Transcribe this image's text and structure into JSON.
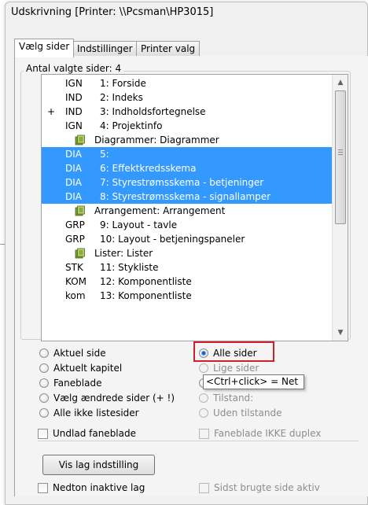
{
  "dialog": {
    "title": "Udskrivning [Printer: \\\\Pcsman\\HP3015]"
  },
  "tabs": [
    {
      "label": "Vælg sider",
      "active": true
    },
    {
      "label": "Indstillinger",
      "active": false
    },
    {
      "label": "Printer valg",
      "active": false
    }
  ],
  "group": {
    "label": "Antal valgte sider: 4"
  },
  "pages": [
    {
      "marker": "",
      "prefix": "IGN",
      "text": "1: Forside",
      "selected": false,
      "folder": false
    },
    {
      "marker": "",
      "prefix": "IND",
      "text": "2: Indeks",
      "selected": false,
      "folder": false
    },
    {
      "marker": "+",
      "prefix": "IND",
      "text": "3: Indholdsfortegnelse",
      "selected": false,
      "folder": false
    },
    {
      "marker": "",
      "prefix": "IGN",
      "text": "4: Projektinfo",
      "selected": false,
      "folder": false
    },
    {
      "marker": "",
      "prefix": "",
      "text": "Diagrammer: Diagrammer",
      "selected": false,
      "folder": true
    },
    {
      "marker": "",
      "prefix": "DIA",
      "text": "5:",
      "selected": true,
      "folder": false
    },
    {
      "marker": "",
      "prefix": "DIA",
      "text": "6: Effektkredsskema",
      "selected": true,
      "folder": false
    },
    {
      "marker": "",
      "prefix": "DIA",
      "text": "7: Styrestrømsskema - betjeninger",
      "selected": true,
      "folder": false
    },
    {
      "marker": "",
      "prefix": "DIA",
      "text": "8: Styrestrømsskema - signallamper",
      "selected": true,
      "folder": false
    },
    {
      "marker": "",
      "prefix": "",
      "text": "Arrangement: Arrangement",
      "selected": false,
      "folder": true
    },
    {
      "marker": "",
      "prefix": "GRP",
      "text": "9: Layout - tavle",
      "selected": false,
      "folder": false
    },
    {
      "marker": "",
      "prefix": "GRP",
      "text": "10: Layout - betjeningspaneler",
      "selected": false,
      "folder": false
    },
    {
      "marker": "",
      "prefix": "",
      "text": "Lister: Lister",
      "selected": false,
      "folder": true
    },
    {
      "marker": "",
      "prefix": "STK",
      "text": "11: Stykliste",
      "selected": false,
      "folder": false
    },
    {
      "marker": "",
      "prefix": "KOM",
      "text": "12: Komponentliste",
      "selected": false,
      "folder": false
    },
    {
      "marker": "",
      "prefix": "kom",
      "text": "13: Komponentliste",
      "selected": false,
      "folder": false
    }
  ],
  "options_left": [
    {
      "label": "Aktuel side",
      "checked": false
    },
    {
      "label": "Aktuelt kapitel",
      "checked": false
    },
    {
      "label": "Faneblade",
      "checked": false
    },
    {
      "label": "Vælg ændrede sider (+ !)",
      "checked": false
    },
    {
      "label": "Alle ikke listesider",
      "checked": false
    }
  ],
  "options_right": {
    "alle_sider": "Alle sider",
    "lige_sider": "Lige sider",
    "tilstand": "Tilstand:",
    "uden_tilstande": "Uden tilstande"
  },
  "tooltip": "<Ctrl+click> = Net",
  "checkboxes": {
    "undlad_faneblade": "Undlad faneblade",
    "faneblade_ikke_duplex": "Faneblade IKKE duplex",
    "nedton_inaktive_lag": "Nedton inaktive lag",
    "sidst_brugte_side_aktiv": "Sidst brugte side aktiv"
  },
  "buttons": {
    "vis_lag_indstilling": "Vis lag indstilling"
  },
  "colors": {
    "selection": "#3399ff",
    "highlight_box": "#d0202a"
  },
  "icons": {
    "folder_rows": "page-folder-icon",
    "scroll_up": "arrow-up-icon",
    "scroll_down": "arrow-down-icon"
  }
}
